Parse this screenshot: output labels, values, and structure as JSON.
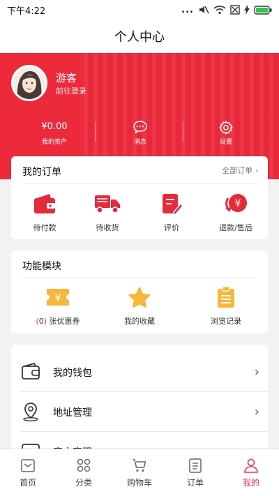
{
  "status_bar": {
    "time": "下午4:22",
    "dots": "..."
  },
  "header": {
    "title": "个人中心"
  },
  "profile": {
    "name": "游客",
    "login_link": "前往登录"
  },
  "stats": [
    {
      "value": "¥0.00",
      "label": "我的资产"
    },
    {
      "label": "消息",
      "icon": "message-icon"
    },
    {
      "label": "设置",
      "icon": "gear-icon"
    }
  ],
  "orders": {
    "title": "我的订单",
    "more": "全部订单",
    "items": [
      {
        "label": "待付款",
        "icon": "wallet-icon"
      },
      {
        "label": "待收货",
        "icon": "truck-icon"
      },
      {
        "label": "评价",
        "icon": "review-icon"
      },
      {
        "label": "退款/售后",
        "icon": "refund-icon"
      }
    ]
  },
  "modules": {
    "title": "功能模块",
    "items": [
      {
        "label": "张优惠券",
        "count_open": "(",
        "count": "0",
        "count_close": ")",
        "icon": "coupon-icon"
      },
      {
        "label": "我的收藏",
        "icon": "star-icon"
      },
      {
        "label": "浏览记录",
        "icon": "clipboard-icon"
      }
    ]
  },
  "list": [
    {
      "label": "我的钱包",
      "icon": "wallet-outline-icon"
    },
    {
      "label": "地址管理",
      "icon": "location-icon"
    },
    {
      "label": "官方客服",
      "icon": "chat-icon"
    }
  ],
  "tabbar": {
    "active_index": 4,
    "items": [
      {
        "label": "首页",
        "icon": "home-icon"
      },
      {
        "label": "分类",
        "icon": "category-icon"
      },
      {
        "label": "购物车",
        "icon": "cart-icon"
      },
      {
        "label": "订单",
        "icon": "order-icon"
      },
      {
        "label": "我的",
        "icon": "user-icon"
      }
    ]
  },
  "colors": {
    "brand_red": "#ec2a3c",
    "accent_yellow": "#f6b73c",
    "active_tab": "#e8325b"
  }
}
